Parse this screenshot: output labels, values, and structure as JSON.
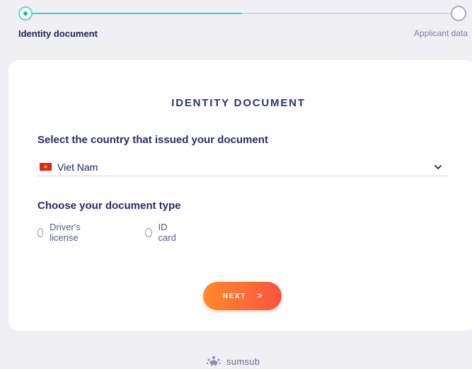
{
  "stepper": {
    "steps": [
      {
        "label": "Identity document",
        "status": "active"
      },
      {
        "label": "Applicant data",
        "status": "pending"
      }
    ],
    "progress": 0.5,
    "colors": {
      "active": "#37d3c2",
      "inactive": "#d4d4e2"
    }
  },
  "card": {
    "title": "IDENTITY DOCUMENT",
    "country_section": {
      "label": "Select the country that issued your document",
      "selected_country": "Viet Nam",
      "flag_icon": "vietnam-flag-icon"
    },
    "doc_type_section": {
      "label": "Choose your document type",
      "options": [
        {
          "label": "Driver's license",
          "selected": false
        },
        {
          "label": "ID card",
          "selected": false
        }
      ]
    },
    "next_button": {
      "label": "NEXT",
      "arrow": ">"
    }
  },
  "footer": {
    "brand": "sumsub"
  },
  "colors": {
    "accent_gradient_start": "#ff8a2c",
    "accent_gradient_end": "#f9543e",
    "heading": "#2e3178"
  }
}
